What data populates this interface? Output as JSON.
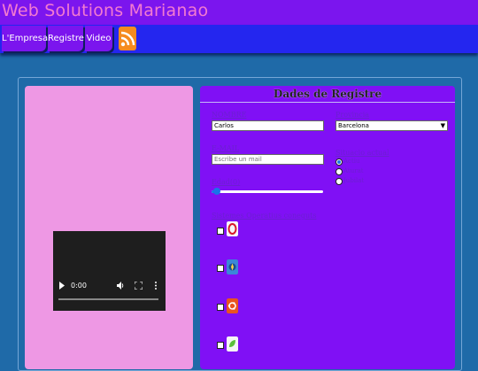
{
  "header": {
    "title": "Web Solutions Marianao"
  },
  "nav": {
    "items": [
      {
        "label": "L'Empresa"
      },
      {
        "label": "Registre"
      },
      {
        "label": "Video"
      }
    ],
    "rss_icon": "rss-icon"
  },
  "video": {
    "time": "0:00"
  },
  "form": {
    "title": "Dades de Registre",
    "nombre": {
      "label": "NOMBRE",
      "value": "Carlos"
    },
    "email": {
      "label": "E-MAIL",
      "placeholder": "Escribe un mail"
    },
    "edad": {
      "label": "Edad(0)",
      "value_fraction": 0.0
    },
    "provincia": {
      "label": "Provincia",
      "selected": "Barcelona"
    },
    "situacion": {
      "label": "Situacio actual",
      "options": [
        "Actiu",
        "Aturat",
        "Jubilat"
      ],
      "selected": "Actiu"
    },
    "sistemas": {
      "label": "Sistemes Operatius coneguts",
      "icons": [
        "opera-icon",
        "pinwheel-icon",
        "ubuntu-icon",
        "leaf-icon"
      ]
    }
  },
  "colors": {
    "header_bg": "#7b15ee",
    "nav_bg": "#2426ef",
    "title_pink": "#f37ad0",
    "left_panel": "#ee98e4",
    "right_panel": "#8010f5",
    "page_bg": "#1f6aa8"
  }
}
